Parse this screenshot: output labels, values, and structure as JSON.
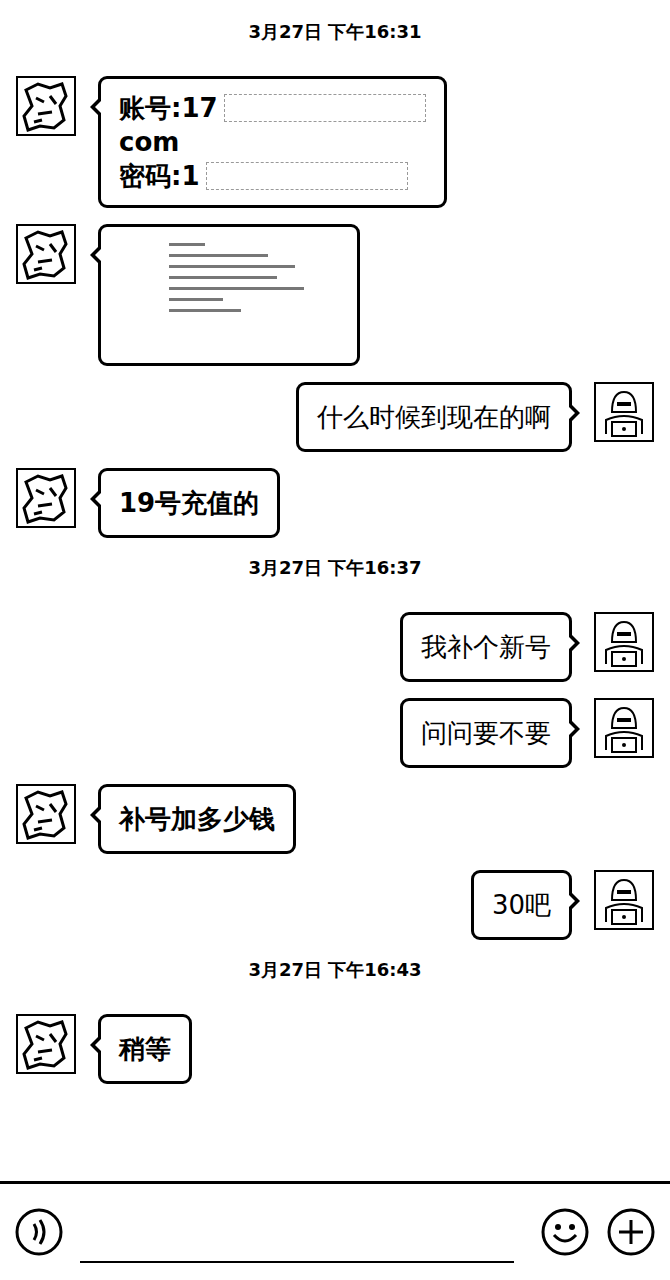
{
  "chat": [
    {
      "kind": "time",
      "text": "3月27日 下午16:31"
    },
    {
      "kind": "account",
      "side": "left",
      "lines": [
        {
          "text": "账号:17",
          "redacted": true
        },
        {
          "text": "com",
          "redacted": false
        },
        {
          "text": "密码:1",
          "redacted": true
        }
      ]
    },
    {
      "kind": "image",
      "side": "left"
    },
    {
      "kind": "text",
      "side": "right",
      "text": "什么时候到现在的啊"
    },
    {
      "kind": "text",
      "side": "left",
      "text": "19号充值的"
    },
    {
      "kind": "time",
      "text": "3月27日 下午16:37"
    },
    {
      "kind": "text",
      "side": "right",
      "text": "我补个新号"
    },
    {
      "kind": "text",
      "side": "right",
      "text": "问问要不要"
    },
    {
      "kind": "text",
      "side": "left",
      "text": "补号加多少钱"
    },
    {
      "kind": "text",
      "side": "right",
      "text": "30吧"
    },
    {
      "kind": "time",
      "text": "3月27日 下午16:43"
    },
    {
      "kind": "text",
      "side": "left",
      "text": "稍等"
    }
  ]
}
